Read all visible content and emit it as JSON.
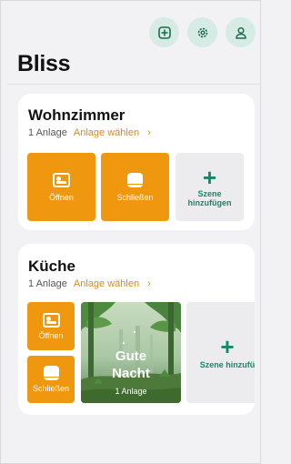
{
  "app": {
    "title": "Bliss"
  },
  "top_actions": [
    {
      "name": "add-plus-square-icon"
    },
    {
      "name": "settings-gear-icon"
    },
    {
      "name": "profile-person-icon"
    }
  ],
  "rooms": [
    {
      "name": "Wohnzimmer",
      "device_count": "1 Anlage",
      "select_link": "Anlage wählen",
      "chevron": "›",
      "tiles": [
        {
          "label": "Öffnen",
          "icon": "open-shade-icon"
        },
        {
          "label": "Schließen",
          "icon": "close-shade-icon"
        }
      ],
      "add_scene": {
        "plus": "+",
        "line1": "Szene",
        "line2": "hinzufügen"
      }
    },
    {
      "name": "Küche",
      "device_count": "1 Anlage",
      "select_link": "Anlage wählen",
      "chevron": "›",
      "tiles": [
        {
          "label": "Öffnen",
          "icon": "open-shade-icon"
        },
        {
          "label": "Schließen",
          "icon": "close-shade-icon"
        }
      ],
      "scene": {
        "title_line1": "Gute",
        "title_line2": "Nacht",
        "subtitle": "1 Anlage"
      },
      "add_scene": {
        "plus": "+",
        "label": "Szene hinzufü"
      }
    }
  ],
  "colors": {
    "accent": "#ef970f",
    "brand_green": "#17876a",
    "icon_bg": "#d5ebe3"
  }
}
